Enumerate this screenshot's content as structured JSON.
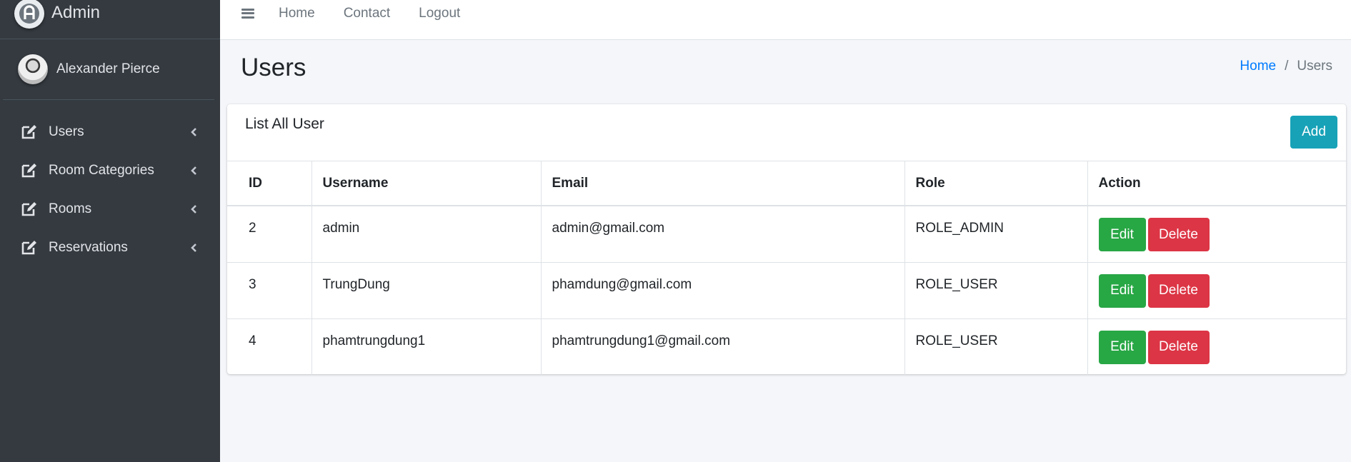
{
  "brand": {
    "name": "Admin",
    "logo_icon": "adminlte-logo-icon"
  },
  "user": {
    "name": "Alexander Pierce"
  },
  "sidebar": {
    "items": [
      {
        "label": "Users",
        "icon": "edit-icon"
      },
      {
        "label": "Room Categories",
        "icon": "edit-icon"
      },
      {
        "label": "Rooms",
        "icon": "edit-icon"
      },
      {
        "label": "Reservations",
        "icon": "edit-icon"
      }
    ]
  },
  "topnav": {
    "menu_icon": "hamburger-icon",
    "links": [
      "Home",
      "Contact",
      "Logout"
    ]
  },
  "page": {
    "title": "Users",
    "breadcrumb": {
      "home": "Home",
      "separator": "/",
      "current": "Users"
    }
  },
  "card": {
    "title": "List All User",
    "add_label": "Add",
    "columns": [
      "ID",
      "Username",
      "Email",
      "Role",
      "Action"
    ],
    "rows": [
      {
        "id": "2",
        "username": "admin",
        "email": "admin@gmail.com",
        "role": "ROLE_ADMIN",
        "edit": "Edit",
        "delete": "Delete"
      },
      {
        "id": "3",
        "username": "TrungDung",
        "email": "phamdung@gmail.com",
        "role": "ROLE_USER",
        "edit": "Edit",
        "delete": "Delete"
      },
      {
        "id": "4",
        "username": "phamtrungdung1",
        "email": "phamtrungdung1@gmail.com",
        "role": "ROLE_USER",
        "edit": "Edit",
        "delete": "Delete"
      }
    ]
  },
  "colors": {
    "sidebar_bg": "#343a40",
    "primary": "#007bff",
    "info": "#17a2b8",
    "success": "#28a745",
    "danger": "#dc3545"
  }
}
